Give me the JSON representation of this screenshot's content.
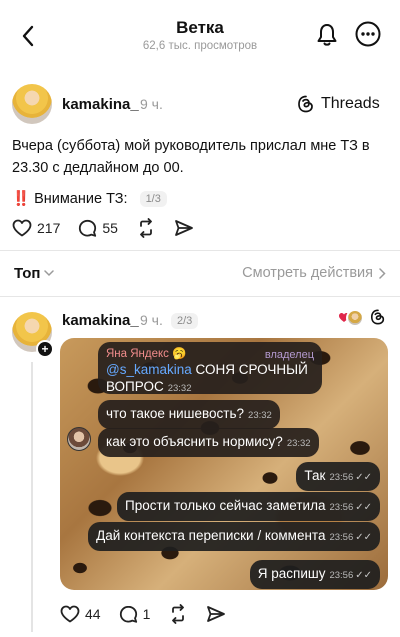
{
  "header": {
    "title": "Ветка",
    "subtitle": "62,6 тыс. просмотров"
  },
  "post": {
    "username": "kamakina_",
    "time": "9 ч.",
    "badge_label": "Threads",
    "text": "Вчера (суббота) мой руководитель прислал мне ТЗ в 23.30 с дедлайном до 00.",
    "attention_marks": "‼️",
    "attention_label": "Внимание ТЗ:",
    "pager": "1/3",
    "likes": "217",
    "comments": "55"
  },
  "sort": {
    "label": "Топ",
    "view_actions": "Смотреть действия"
  },
  "reply": {
    "username": "kamakina_",
    "time": "9 ч.",
    "pager": "2/3",
    "likes": "44",
    "comments": "1"
  },
  "chat": {
    "first_sender": "Яна Яндекс",
    "sender_emoji": "🥱",
    "role": "владелец",
    "first_mention": "@s_kamakina",
    "first_text": " СОНЯ СРОЧНЫЙ ВОПРОС",
    "first_time": "23:32",
    "messages": [
      {
        "text": "что такое нишевость?",
        "time": "23:32",
        "side": "in"
      },
      {
        "text": "как это объяснить нормису?",
        "time": "23:32",
        "side": "in"
      },
      {
        "text": "Так",
        "time": "23:56",
        "side": "out"
      },
      {
        "text": "Прости только сейчас заметила",
        "time": "23:56",
        "side": "out"
      },
      {
        "text": "Дай контекста переписки / коммента",
        "time": "23:56",
        "side": "out"
      },
      {
        "text": "Я распишу",
        "time": "23:56",
        "side": "out"
      }
    ]
  },
  "colors": {
    "accent": "#111111",
    "muted": "#9a9a9a",
    "attention_red": "#d62020",
    "heart_red": "#e0264a"
  }
}
